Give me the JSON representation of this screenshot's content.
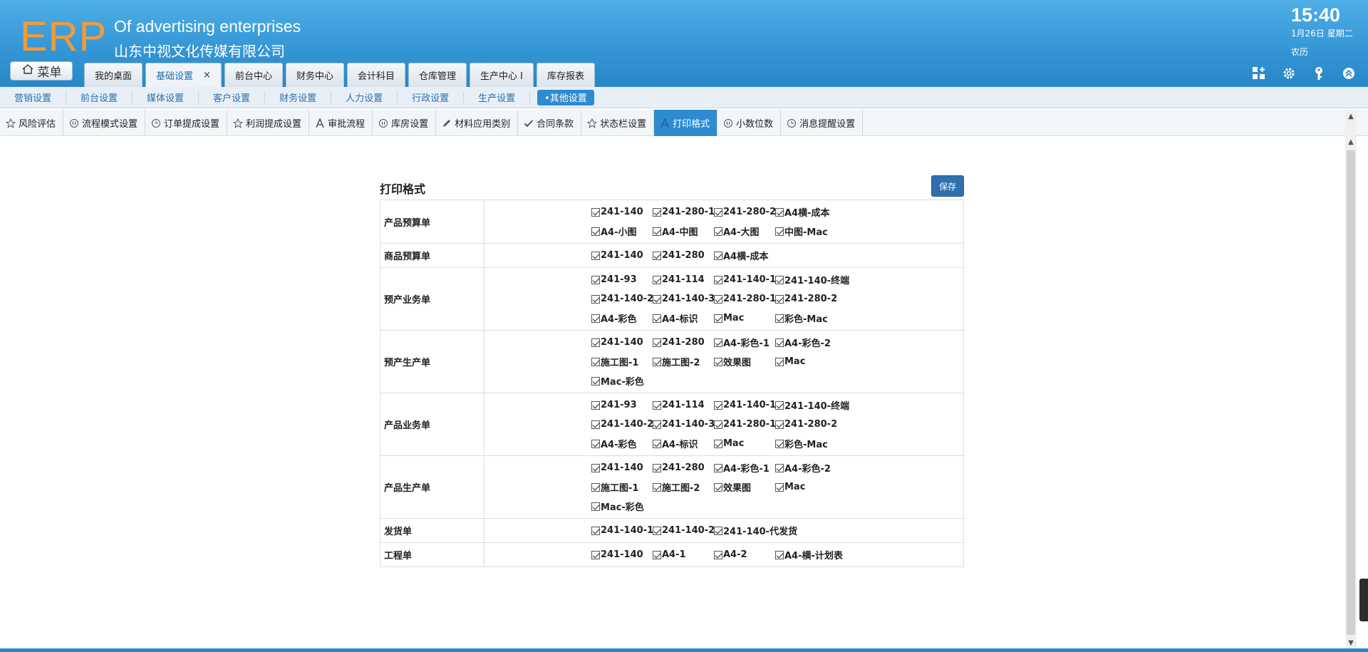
{
  "header": {
    "logo": "ERP",
    "company_en": "Of advertising enterprises",
    "company_cn": "山东中视文化传媒有限公司",
    "menu_label": "菜单",
    "time": "15:40",
    "date": "1月26日 星期二",
    "lunar": "农历",
    "tabs": [
      {
        "label": "我的桌面"
      },
      {
        "label": "基础设置",
        "close": "×"
      },
      {
        "label": "前台中心"
      },
      {
        "label": "财务中心"
      },
      {
        "label": "会计科目"
      },
      {
        "label": "仓库管理"
      },
      {
        "label": "生产中心 I"
      },
      {
        "label": "库存报表"
      }
    ],
    "tools": [
      "grid-add-icon",
      "gear-icon",
      "key-icon",
      "collapse-icon"
    ]
  },
  "submenu": [
    "营销设置",
    "前台设置",
    "媒体设置",
    "客户设置",
    "财务设置",
    "人力设置",
    "行政设置",
    "生产设置",
    "•其他设置"
  ],
  "tooltabs": [
    {
      "label": "风险评估",
      "icon": "star-icon"
    },
    {
      "label": "流程模式设置",
      "icon": "pause-circle-icon"
    },
    {
      "label": "订单提成设置",
      "icon": "clock-icon"
    },
    {
      "label": "利润提成设置",
      "icon": "star-icon"
    },
    {
      "label": "审批流程",
      "icon": "font-a-icon"
    },
    {
      "label": "库房设置",
      "icon": "pause-circle-icon"
    },
    {
      "label": "材料应用类别",
      "icon": "pencil-icon"
    },
    {
      "label": "合同条款",
      "icon": "check-icon"
    },
    {
      "label": "状态栏设置",
      "icon": "star-icon"
    },
    {
      "label": "打印格式",
      "icon": "font-a-icon"
    },
    {
      "label": "小数位数",
      "icon": "pause-circle-icon"
    },
    {
      "label": "消息提醒设置",
      "icon": "clock-icon"
    }
  ],
  "panel": {
    "title": "打印格式",
    "save_label": "保存",
    "rows": [
      {
        "label": "产品预算单",
        "lines": [
          [
            "241-140",
            "241-280-1",
            "241-280-2",
            "A4横-成本"
          ],
          [
            "A4-小图",
            "A4-中图",
            "A4-大图",
            "中图-Mac"
          ]
        ]
      },
      {
        "label": "商品预算单",
        "lines": [
          [
            "241-140",
            "241-280",
            "A4横-成本"
          ]
        ]
      },
      {
        "label": "预产业务单",
        "lines": [
          [
            "241-93",
            "241-114",
            "241-140-1",
            "241-140-终端"
          ],
          [
            "241-140-2",
            "241-140-3",
            "241-280-1",
            "241-280-2"
          ],
          [
            "A4-彩色",
            "A4-标识",
            "Mac",
            "彩色-Mac"
          ]
        ]
      },
      {
        "label": "预产生产单",
        "lines": [
          [
            "241-140",
            "241-280",
            "A4-彩色-1",
            "A4-彩色-2"
          ],
          [
            "施工图-1",
            "施工图-2",
            "效果图",
            "Mac"
          ],
          [
            "Mac-彩色"
          ]
        ]
      },
      {
        "label": "产品业务单",
        "lines": [
          [
            "241-93",
            "241-114",
            "241-140-1",
            "241-140-终端"
          ],
          [
            "241-140-2",
            "241-140-3",
            "241-280-1",
            "241-280-2"
          ],
          [
            "A4-彩色",
            "A4-标识",
            "Mac",
            "彩色-Mac"
          ]
        ]
      },
      {
        "label": "产品生产单",
        "lines": [
          [
            "241-140",
            "241-280",
            "A4-彩色-1",
            "A4-彩色-2"
          ],
          [
            "施工图-1",
            "施工图-2",
            "效果图",
            "Mac"
          ],
          [
            "Mac-彩色"
          ]
        ]
      },
      {
        "label": "发货单",
        "lines": [
          [
            "241-140-1",
            "241-140-2",
            "241-140-代发货"
          ]
        ]
      },
      {
        "label": "工程单",
        "lines": [
          [
            "241-140",
            "A4-1",
            "A4-2",
            "A4-横-计划表"
          ]
        ]
      }
    ]
  }
}
